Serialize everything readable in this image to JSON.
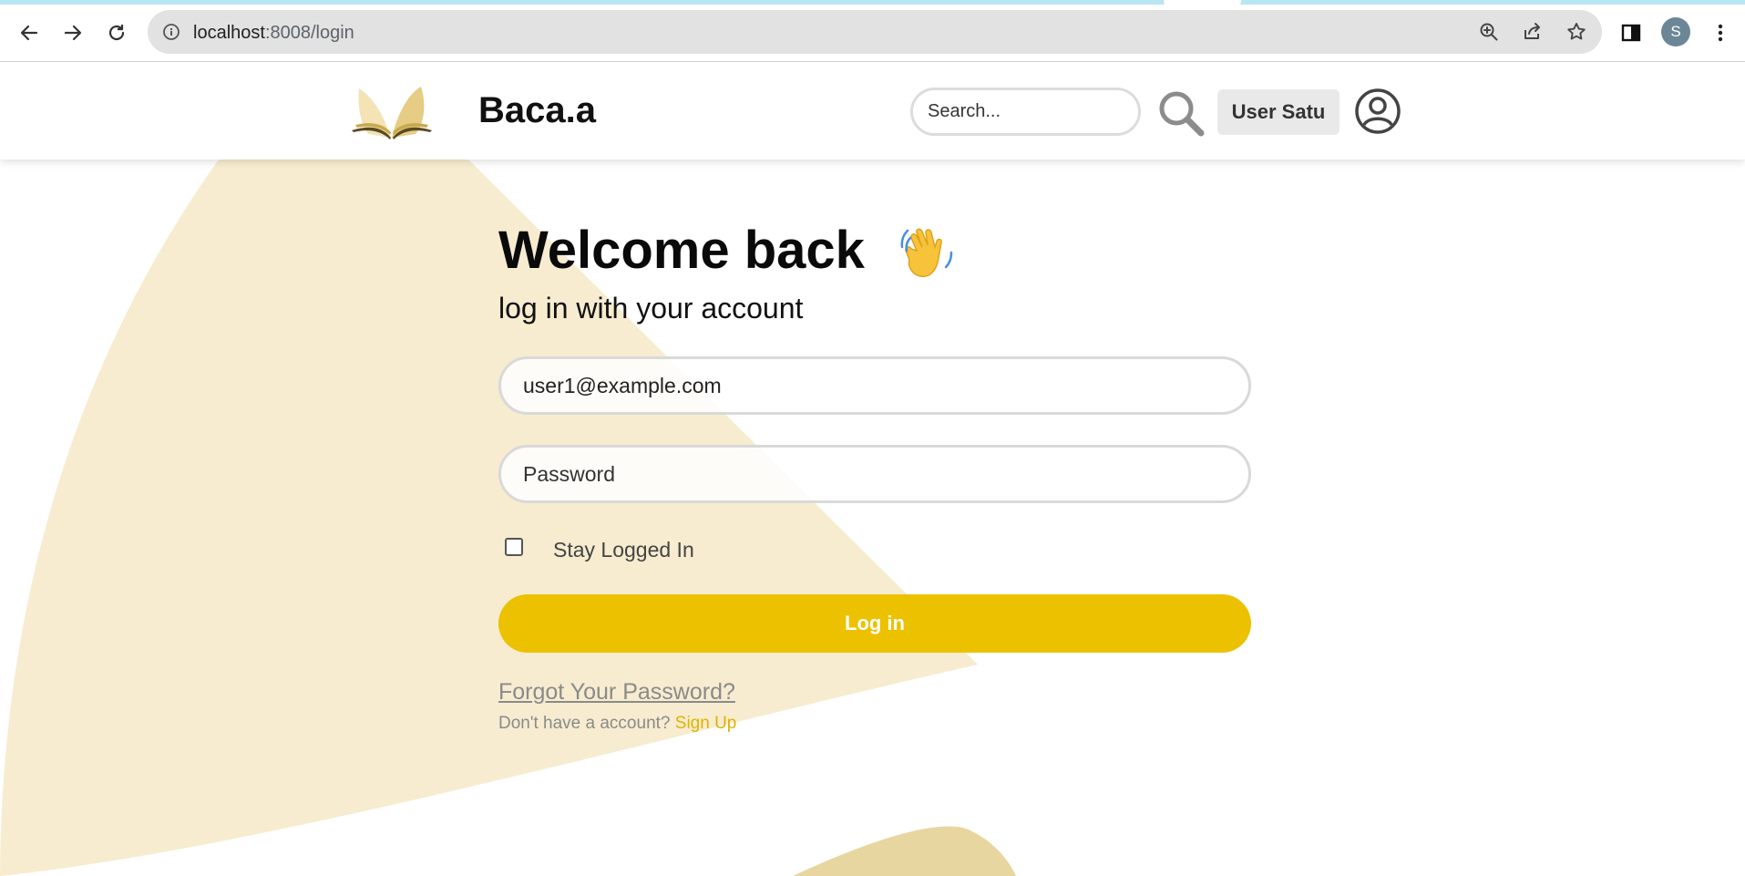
{
  "browser": {
    "url_host": "localhost",
    "url_path": ":8008/login",
    "profile_initial": "S",
    "icons": [
      "back-arrow-icon",
      "forward-arrow-icon",
      "reload-icon",
      "info-icon",
      "zoom-icon",
      "share-icon",
      "star-icon",
      "sidebar-icon",
      "kebab-menu-icon"
    ]
  },
  "header": {
    "brand": "Baca.a",
    "search_placeholder": "Search...",
    "user_name": "User Satu"
  },
  "login": {
    "title": "Welcome back",
    "subtitle": "log in with your account",
    "email_value": "user1@example.com",
    "password_placeholder": "Password",
    "remember_label": "Stay Logged In",
    "remember_checked": false,
    "submit_label": "Log in",
    "forgot_label": "Forgot Your Password?",
    "signup_prompt": "Don't have a account? ",
    "signup_label": "Sign Up"
  },
  "colors": {
    "accent": "#ecc100",
    "background_shape": "#f7ecd0",
    "background_shape_dark": "#e8d6a0"
  }
}
